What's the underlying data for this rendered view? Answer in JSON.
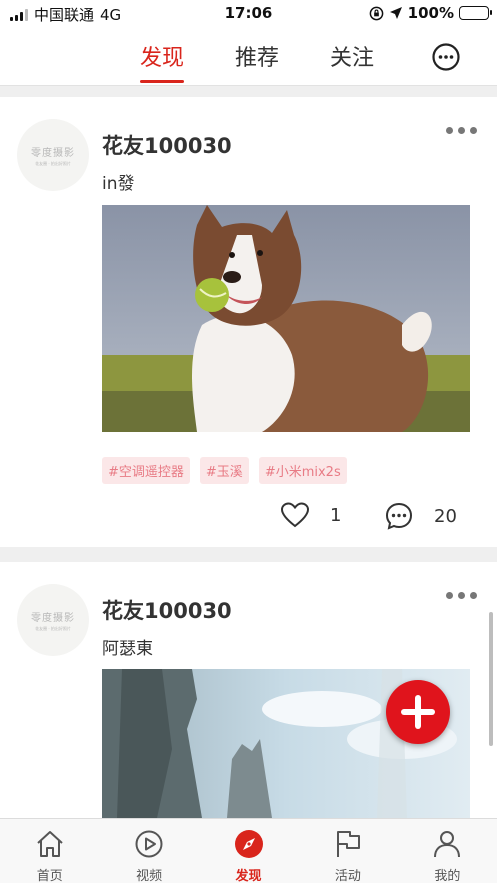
{
  "status_bar": {
    "carrier": "中国联通",
    "network": "4G",
    "time": "17:06",
    "battery": "100%"
  },
  "top_nav": {
    "tabs": [
      {
        "label": "发现",
        "active": true
      },
      {
        "label": "推荐",
        "active": false
      },
      {
        "label": "关注",
        "active": false
      }
    ],
    "icon": "chat-bubble-icon"
  },
  "posts": [
    {
      "avatar": {
        "brand": "零度摄影",
        "sub": "花友圈 · 拍出好照片"
      },
      "username": "花友100030",
      "text": "in發",
      "image": "dog-with-tennis-ball-photo",
      "tags": [
        "#空调遥控器",
        "#玉溪",
        "#小米mix2s"
      ],
      "likes": "1",
      "comments": "20"
    },
    {
      "avatar": {
        "brand": "零度摄影",
        "sub": "花友圈 · 拍出好照片"
      },
      "username": "花友100030",
      "text": "阿瑟東",
      "image": "rocky-cliffs-sky-photo"
    }
  ],
  "bottom_nav": {
    "items": [
      {
        "label": "首页",
        "icon": "home-icon",
        "active": false
      },
      {
        "label": "视频",
        "icon": "play-icon",
        "active": false
      },
      {
        "label": "发现",
        "icon": "compass-icon",
        "active": true
      },
      {
        "label": "活动",
        "icon": "flag-icon",
        "active": false
      },
      {
        "label": "我的",
        "icon": "user-icon",
        "active": false
      }
    ]
  },
  "colors": {
    "accent": "#d9251c",
    "tag_bg": "#fbe7e8",
    "tag_text": "#e87b85",
    "fab": "#e0141c"
  }
}
